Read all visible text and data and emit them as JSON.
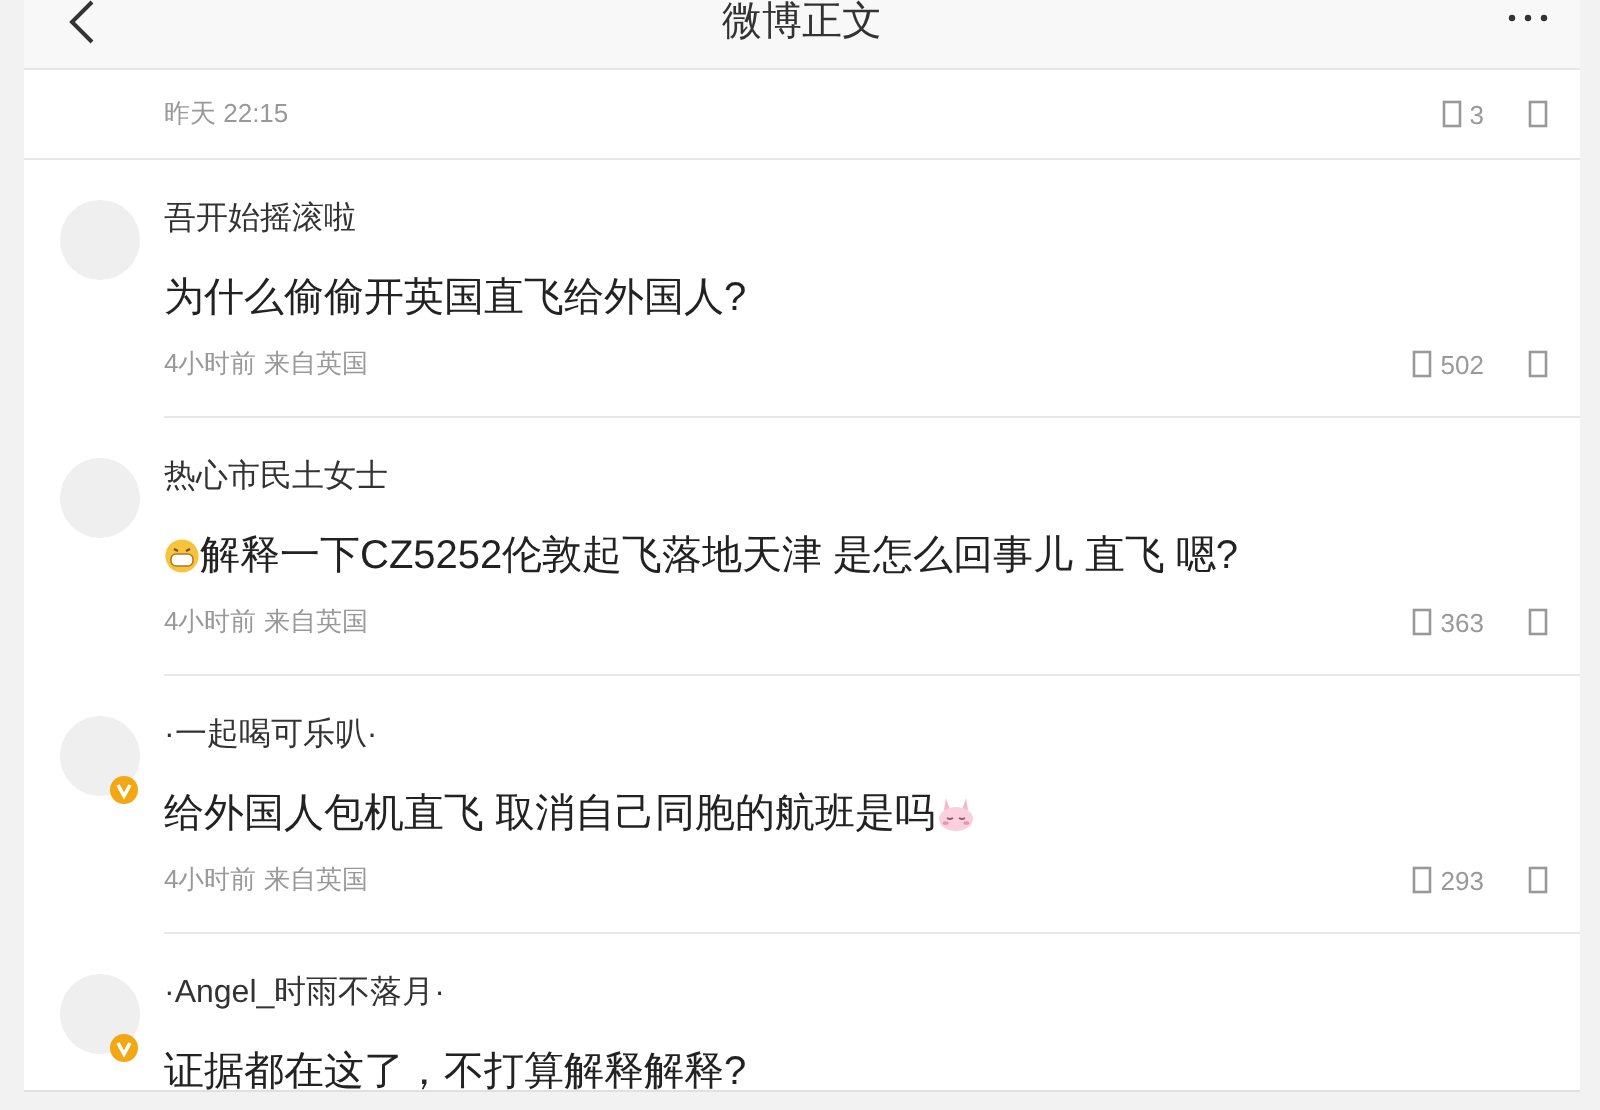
{
  "header": {
    "title": "微博正文"
  },
  "post_meta": {
    "time": "昨天 22:15",
    "count": "3"
  },
  "comments": [
    {
      "name": "吾开始摇滚啦",
      "verified": false,
      "content": [
        {
          "kind": "text",
          "text": "为什么偷偷开英国直飞给外国人?"
        }
      ],
      "time": "4小时前",
      "location": "来自英国",
      "likes": "502"
    },
    {
      "name": "热心市民土女士",
      "verified": false,
      "content": [
        {
          "kind": "grin"
        },
        {
          "kind": "text",
          "text": "解释一下CZ5252伦敦起飞落地天津 是怎么回事儿 直飞 嗯?"
        }
      ],
      "time": "4小时前",
      "location": "来自英国",
      "likes": "363"
    },
    {
      "name": "·一起喝可乐叭·",
      "verified": true,
      "content": [
        {
          "kind": "text",
          "text": "给外国人包机直飞 取消自己同胞的航班是吗"
        },
        {
          "kind": "bunny"
        }
      ],
      "time": "4小时前",
      "location": "来自英国",
      "likes": "293"
    },
    {
      "name": "·Angel_时雨不落月·",
      "verified": true,
      "content": [
        {
          "kind": "text",
          "text": "证据都在这了，不打算解释解释?"
        }
      ]
    }
  ]
}
